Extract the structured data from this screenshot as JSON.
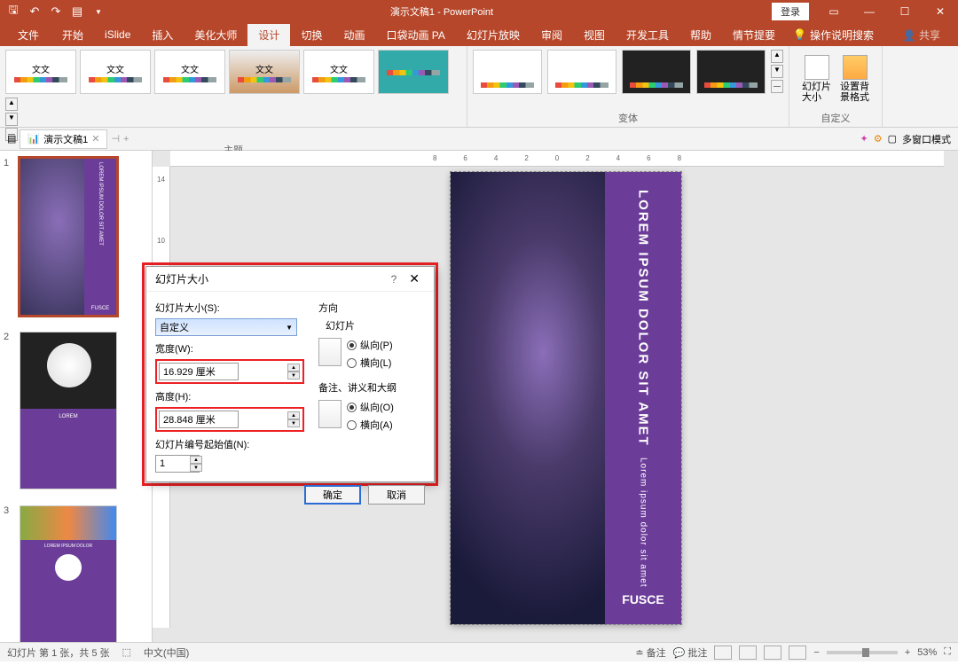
{
  "titlebar": {
    "title": "演示文稿1 - PowerPoint",
    "login": "登录"
  },
  "tabs": {
    "file": "文件",
    "home": "开始",
    "islide": "iSlide",
    "insert": "插入",
    "beautify": "美化大师",
    "design": "设计",
    "transition": "切换",
    "anim": "动画",
    "pocket": "口袋动画 PA",
    "slideshow": "幻灯片放映",
    "review": "审阅",
    "view": "视图",
    "dev": "开发工具",
    "help": "帮助",
    "plot": "情节提要",
    "tellme": "操作说明搜索"
  },
  "ribbon": {
    "themes_label": "主题",
    "variants_label": "变体",
    "custom_label": "自定义",
    "theme_text": "文文",
    "slide_size": "幻灯片\n大小",
    "bg_format": "设置背\n景格式"
  },
  "docbar": {
    "name": "演示文稿1",
    "multiwindow": "多窗口模式"
  },
  "slides": {
    "n1": "1",
    "n2": "2",
    "n3": "3"
  },
  "canvas": {
    "title": "LOREM IPSUM DOLOR SIT AMET",
    "sub": "Lorem ipsum dolor sit amet",
    "foot": "FUSCE"
  },
  "thumb2": {
    "label": "LOREM"
  },
  "thumb3": {
    "label": "LOREM IPSUM DOLOR"
  },
  "ruler": {
    "m8a": "8",
    "m6a": "6",
    "m4a": "4",
    "m2a": "2",
    "m0": "0",
    "m2b": "2",
    "m4b": "4",
    "m6b": "6",
    "m8b": "8",
    "v14": "14",
    "v10": "10"
  },
  "dialog": {
    "title": "幻灯片大小",
    "size_label": "幻灯片大小(S):",
    "size_value": "自定义",
    "width_label": "宽度(W):",
    "width_value": "16.929 厘米",
    "height_label": "高度(H):",
    "height_value": "28.848 厘米",
    "startnum_label": "幻灯片编号起始值(N):",
    "startnum_value": "1",
    "orientation_label": "方向",
    "slides_label": "幻灯片",
    "notes_label": "备注、讲义和大纲",
    "portrait_p": "纵向(P)",
    "landscape_l": "横向(L)",
    "portrait_o": "纵向(O)",
    "landscape_a": "横向(A)",
    "ok": "确定",
    "cancel": "取消"
  },
  "status": {
    "slide_info": "幻灯片 第 1 张，共 5 张",
    "lang": "中文(中国)",
    "notes": "备注",
    "comments": "批注",
    "zoom": "53%"
  },
  "share": "共享",
  "icons": {
    "ppt": "📊",
    "gear": "⚙",
    "bulb": "💡",
    "help": "?"
  }
}
